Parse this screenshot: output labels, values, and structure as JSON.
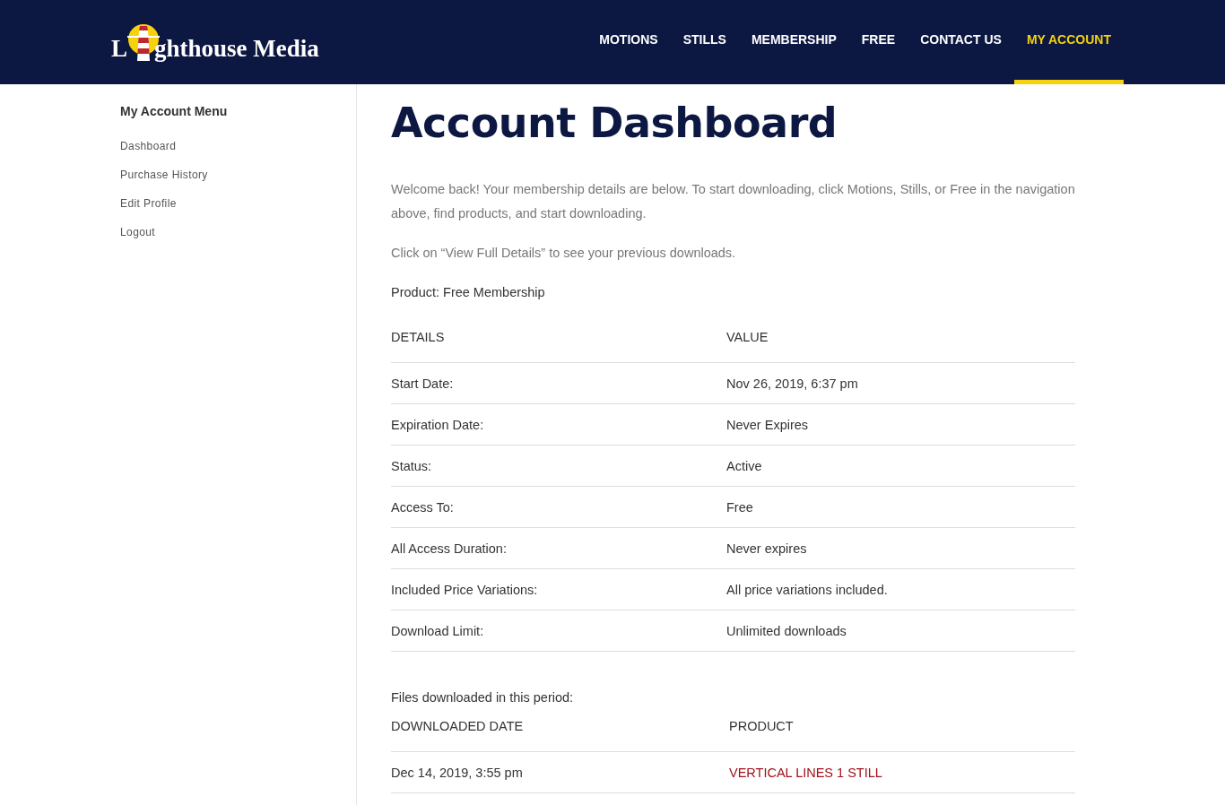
{
  "header": {
    "logo": {
      "lead": "L",
      "rest": "ghthouse Media"
    },
    "nav": [
      {
        "label": "MOTIONS",
        "selected": false
      },
      {
        "label": "STILLS",
        "selected": false
      },
      {
        "label": "MEMBERSHIP",
        "selected": false
      },
      {
        "label": "FREE",
        "selected": false
      },
      {
        "label": "CONTACT US",
        "selected": false
      },
      {
        "label": "MY ACCOUNT",
        "selected": true
      }
    ]
  },
  "sidebar": {
    "title": "My Account Menu",
    "items": [
      "Dashboard",
      "Purchase History",
      "Edit Profile",
      "Logout"
    ]
  },
  "main": {
    "title": "Account Dashboard",
    "intro": [
      "Welcome back! Your membership details are below. To start downloading, click Motions, Stills, or Free in the navigation above, find products, and start downloading.",
      "Click on “View Full Details” to see your previous downloads."
    ],
    "product": "Product: Free Membership",
    "details_table": {
      "columns": [
        "DETAILS",
        "VALUE"
      ],
      "rows": [
        [
          "Start Date:",
          "Nov 26, 2019, 6:37 pm"
        ],
        [
          "Expiration Date:",
          "Never Expires"
        ],
        [
          "Status:",
          "Active"
        ],
        [
          "Access To:",
          "Free"
        ],
        [
          "All Access Duration:",
          "Never expires"
        ],
        [
          "Included Price Variations:",
          "All price variations included."
        ],
        [
          "Download Limit:",
          "Unlimited downloads"
        ]
      ]
    },
    "downloads_label": "Files downloaded in this period:",
    "downloads_table": {
      "columns": [
        "DOWNLOADED DATE",
        "PRODUCT"
      ],
      "rows": [
        {
          "date": "Dec 14, 2019, 3:55 pm",
          "product": "VERTICAL LINES 1 STILL"
        }
      ]
    }
  }
}
